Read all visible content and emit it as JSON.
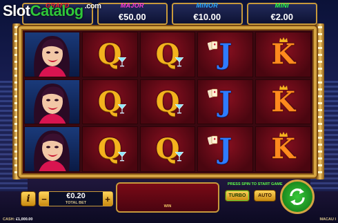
{
  "logo": {
    "brand": "Slot",
    "accent": "Catalog",
    "suffix": ".com"
  },
  "jackpots": [
    {
      "name": "GRAND",
      "value": ""
    },
    {
      "name": "MAJOR",
      "value": "€50.00"
    },
    {
      "name": "MINOR",
      "value": "€10.00"
    },
    {
      "name": "MINI",
      "value": "€2.00"
    }
  ],
  "reels": [
    {
      "symbol": "wild-woman",
      "letter": ""
    },
    {
      "symbol": "queen-martini",
      "letter": "Q"
    },
    {
      "symbol": "queen-martini",
      "letter": "Q"
    },
    {
      "symbol": "jack-cards",
      "letter": "J"
    },
    {
      "symbol": "king-crown",
      "letter": "K"
    }
  ],
  "controls": {
    "info_label": "i",
    "minus_label": "−",
    "plus_label": "+",
    "bet_value": "€0.20",
    "bet_label": "TOTAL BET",
    "win_label": "WIN",
    "press_hint": "PRESS SPIN TO START GAME",
    "turbo_label": "TURBO",
    "auto_label": "AUTO",
    "cash_label": "CASH:",
    "cash_value": "£1,000.00",
    "game_name": "MACAU I"
  },
  "colors": {
    "frame_gold": "#d4a442",
    "reel_red": "#4a0610",
    "spin_green": "#1a8a1e"
  }
}
